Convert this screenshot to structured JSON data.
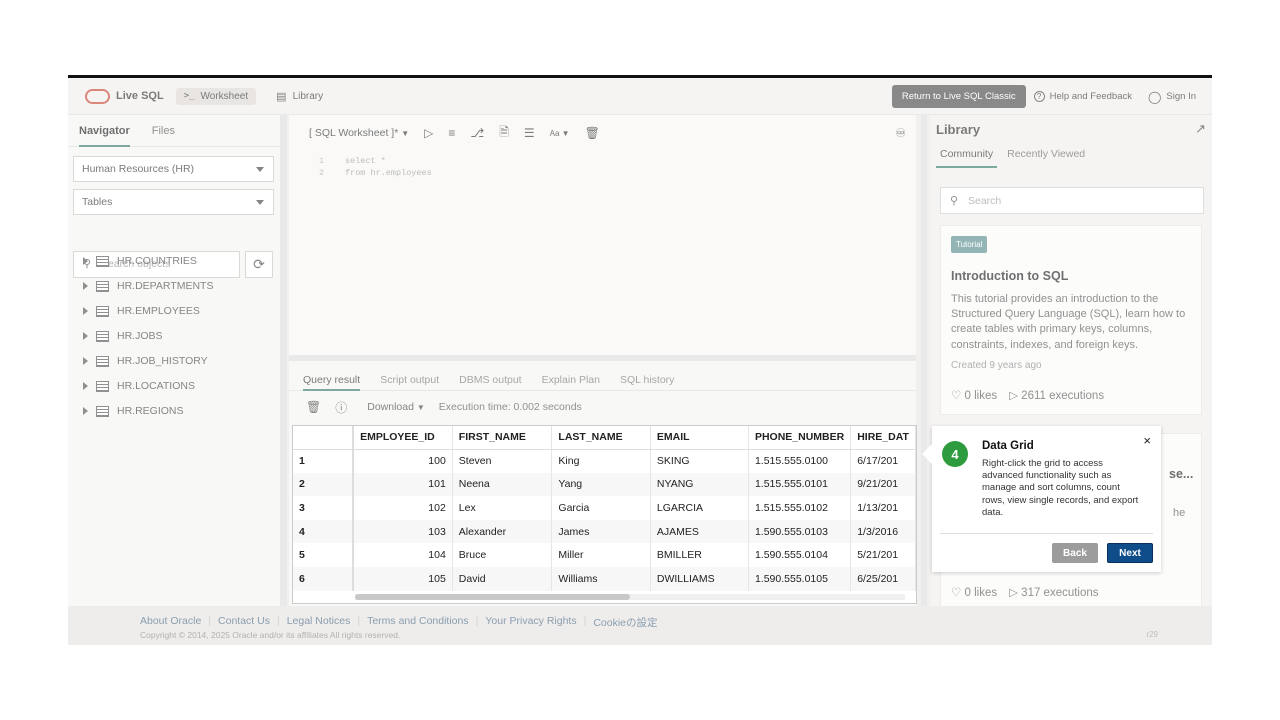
{
  "header": {
    "brand": "Live SQL",
    "worksheet": "Worksheet",
    "library": "Library",
    "classic": "Return to Live SQL Classic",
    "help": "Help and Feedback",
    "signin": "Sign In"
  },
  "navigator": {
    "tabs": [
      "Navigator",
      "Files"
    ],
    "schema": "Human Resources (HR)",
    "object_type": "Tables",
    "search_placeholder": "Search objects",
    "tables": [
      "HR.COUNTRIES",
      "HR.DEPARTMENTS",
      "HR.EMPLOYEES",
      "HR.JOBS",
      "HR.JOB_HISTORY",
      "HR.LOCATIONS",
      "HR.REGIONS"
    ]
  },
  "editor": {
    "title": "[ SQL Worksheet ]*",
    "font_label": "Aa",
    "lines": [
      {
        "n": "1",
        "code": "select *"
      },
      {
        "n": "2",
        "code": "from hr.employees"
      }
    ]
  },
  "results": {
    "tabs": [
      "Query result",
      "Script output",
      "DBMS output",
      "Explain Plan",
      "SQL history"
    ],
    "download": "Download",
    "execution_time": "Execution time: 0.002 seconds",
    "columns": [
      "EMPLOYEE_ID",
      "FIRST_NAME",
      "LAST_NAME",
      "EMAIL",
      "PHONE_NUMBER",
      "HIRE_DAT"
    ],
    "rows": [
      [
        "1",
        "100",
        "Steven",
        "King",
        "SKING",
        "1.515.555.0100",
        "6/17/201"
      ],
      [
        "2",
        "101",
        "Neena",
        "Yang",
        "NYANG",
        "1.515.555.0101",
        "9/21/201"
      ],
      [
        "3",
        "102",
        "Lex",
        "Garcia",
        "LGARCIA",
        "1.515.555.0102",
        "1/13/201"
      ],
      [
        "4",
        "103",
        "Alexander",
        "James",
        "AJAMES",
        "1.590.555.0103",
        "1/3/2016"
      ],
      [
        "5",
        "104",
        "Bruce",
        "Miller",
        "BMILLER",
        "1.590.555.0104",
        "5/21/201"
      ],
      [
        "6",
        "105",
        "David",
        "Williams",
        "DWILLIAMS",
        "1.590.555.0105",
        "6/25/201"
      ]
    ]
  },
  "library": {
    "title": "Library",
    "tabs": [
      "Community",
      "Recently Viewed"
    ],
    "search_placeholder": "Search",
    "card": {
      "tag": "Tutorial",
      "title": "Introduction to SQL",
      "desc": "This tutorial provides an introduction to the Structured Query Language (SQL), learn how to create tables with primary keys, columns, constraints, indexes, and foreign keys.",
      "created": "Created 9 years ago",
      "likes": "0 likes",
      "executions": "2611 executions"
    },
    "card2": {
      "title_fragment": "se...",
      "body_fragment": "he",
      "likes": "0 likes",
      "executions": "317 executions"
    }
  },
  "popup": {
    "step": "4",
    "title": "Data Grid",
    "body": "Right-click the grid to access advanced functionality such as manage and sort columns, count rows, view single records, and export data.",
    "back": "Back",
    "next": "Next",
    "close": "×"
  },
  "footer": {
    "links": [
      "About Oracle",
      "Contact Us",
      "Legal Notices",
      "Terms and Conditions",
      "Your Privacy Rights",
      "Cookieの設定"
    ],
    "copyright": "Copyright © 2014, 2025 Oracle and/or its affiliates All rights reserved.",
    "version": "r29"
  },
  "colors": {
    "accent": "#3a7c6a",
    "step": "#2e9b3e",
    "next": "#0f4c8a",
    "logo": "#c74634"
  }
}
